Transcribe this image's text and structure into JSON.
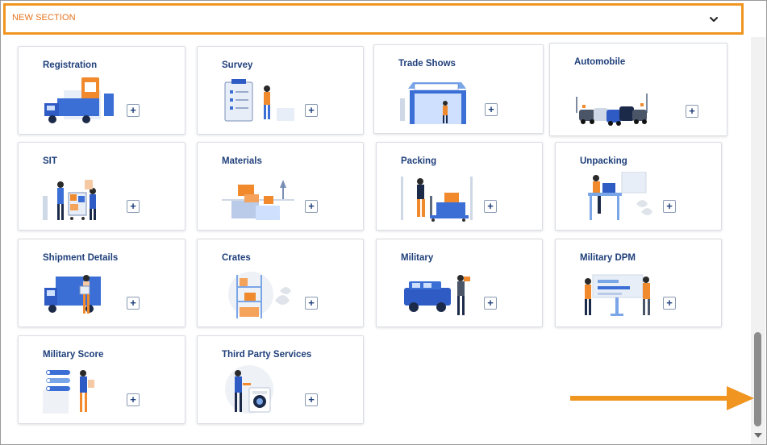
{
  "section": {
    "title": "NEW SECTION",
    "icon": "chevron-down-icon"
  },
  "cards": [
    {
      "label": "Registration",
      "illustration": "delivery-truck-illustration"
    },
    {
      "label": "Survey",
      "illustration": "checklist-clipboard-illustration"
    },
    {
      "label": "Trade Shows",
      "illustration": "trade-show-booth-illustration"
    },
    {
      "label": "Automobile",
      "illustration": "parked-cars-illustration"
    },
    {
      "label": "SIT",
      "illustration": "storage-cart-illustration"
    },
    {
      "label": "Materials",
      "illustration": "boxes-materials-illustration"
    },
    {
      "label": "Packing",
      "illustration": "hand-truck-boxes-illustration"
    },
    {
      "label": "Unpacking",
      "illustration": "unpacking-desk-illustration"
    },
    {
      "label": "Shipment Details",
      "illustration": "shipment-truck-illustration"
    },
    {
      "label": "Crates",
      "illustration": "crates-shelf-illustration"
    },
    {
      "label": "Military",
      "illustration": "military-vehicle-illustration"
    },
    {
      "label": "Military DPM",
      "illustration": "military-dpm-board-illustration"
    },
    {
      "label": "Military Score",
      "illustration": "score-list-illustration"
    },
    {
      "label": "Third Party Services",
      "illustration": "technician-services-illustration"
    }
  ],
  "add_button_label": "+",
  "colors": {
    "accent": "#f0951f",
    "title": "#1f3f7a",
    "section_title": "#e8731c"
  }
}
